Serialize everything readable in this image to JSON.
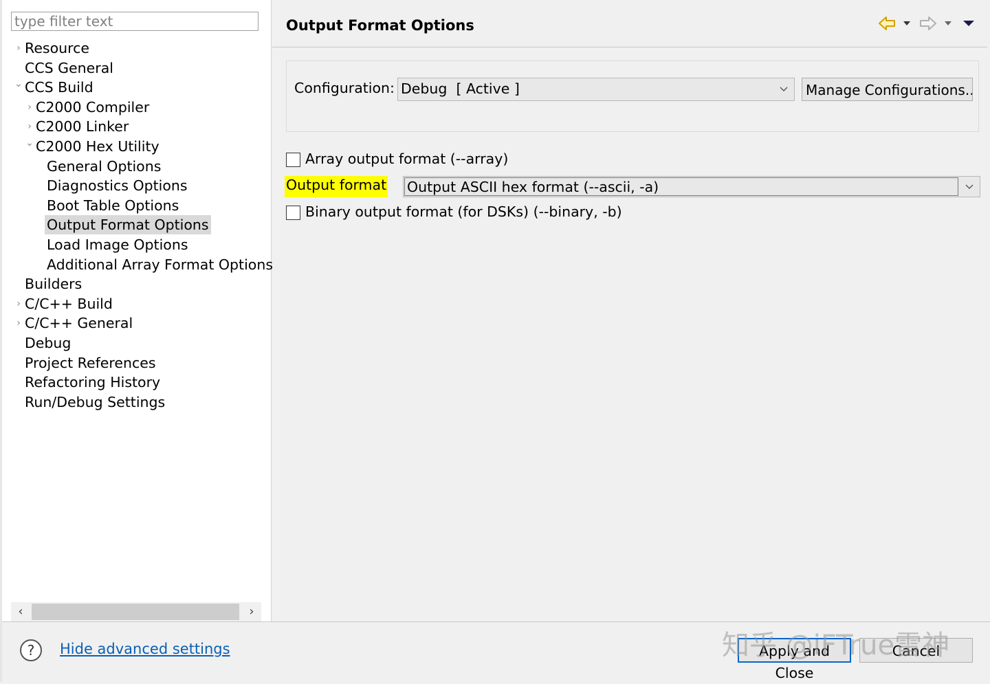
{
  "filter": {
    "placeholder": "type filter text"
  },
  "tree": {
    "items": [
      {
        "label": "Resource",
        "twisty": "collapsed"
      },
      {
        "label": "CCS General",
        "twisty": "none"
      },
      {
        "label": "CCS Build",
        "twisty": "expanded"
      },
      {
        "label": "C2000 Compiler",
        "twisty": "collapsed"
      },
      {
        "label": "C2000 Linker",
        "twisty": "collapsed"
      },
      {
        "label": "C2000 Hex Utility",
        "twisty": "expanded"
      },
      {
        "label": "General Options",
        "twisty": "none"
      },
      {
        "label": "Diagnostics Options",
        "twisty": "none"
      },
      {
        "label": "Boot Table Options",
        "twisty": "none"
      },
      {
        "label": "Output Format Options",
        "twisty": "none",
        "selected": true
      },
      {
        "label": "Load Image Options",
        "twisty": "none"
      },
      {
        "label": "Additional Array Format Options",
        "twisty": "none"
      },
      {
        "label": "Builders",
        "twisty": "none"
      },
      {
        "label": "C/C++ Build",
        "twisty": "collapsed"
      },
      {
        "label": "C/C++ General",
        "twisty": "collapsed"
      },
      {
        "label": "Debug",
        "twisty": "none"
      },
      {
        "label": "Project References",
        "twisty": "none"
      },
      {
        "label": "Refactoring History",
        "twisty": "none"
      },
      {
        "label": "Run/Debug Settings",
        "twisty": "none"
      }
    ]
  },
  "page": {
    "title": "Output Format Options"
  },
  "nav": {
    "back_icon": "back-arrow-icon",
    "forward_icon": "forward-arrow-icon",
    "menu_icon": "view-menu-icon"
  },
  "config": {
    "label": "Configuration:",
    "value": "Debug  [ Active ]",
    "manage_label": "Manage Configurations..."
  },
  "options": {
    "array_label": "Array output format (--array)",
    "array_checked": false,
    "output_format_label": "Output format",
    "output_format_value": "Output ASCII hex format (--ascii, -a)",
    "binary_label": "Binary output format (for DSKs) (--binary, -b)",
    "binary_checked": false
  },
  "footer": {
    "hide_advanced_label": "Hide advanced settings",
    "apply_close_label": "Apply and Close",
    "cancel_label": "Cancel"
  },
  "watermark": "知乎 @iFTrue雷神",
  "colors": {
    "highlight": "#ffff00",
    "link": "#0b5fb5",
    "default_button_border": "#0a64c8",
    "selection": "#d9d9d9",
    "back_arrow": "#e8b800"
  }
}
